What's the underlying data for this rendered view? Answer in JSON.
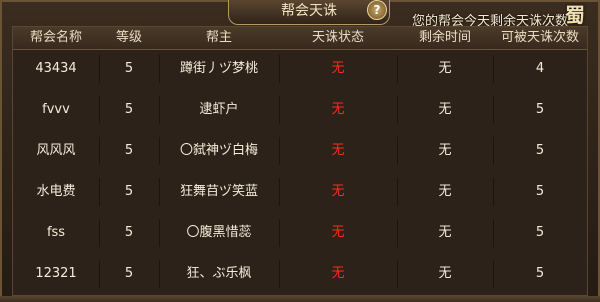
{
  "title": "帮会天诛",
  "help_label": "?",
  "count_label": "您的帮会今天剩余天诛次数",
  "logo_text": "蜀門",
  "columns": [
    "帮会名称",
    "等级",
    "帮主",
    "天诛状态",
    "剩余时间",
    "可被天诛次数"
  ],
  "rows": [
    {
      "name": "43434",
      "level": "5",
      "leader": "蹲街丿ヅ梦桃",
      "status": "无",
      "remaining": "无",
      "times": "4"
    },
    {
      "name": "fvvv",
      "level": "5",
      "leader": "逮虾户",
      "status": "无",
      "remaining": "无",
      "times": "5"
    },
    {
      "name": "风风风",
      "level": "5",
      "leader": "〇弑神ヅ白梅",
      "status": "无",
      "remaining": "无",
      "times": "5"
    },
    {
      "name": "水电费",
      "level": "5",
      "leader": "狂舞䒤ヅ笑蓝",
      "status": "无",
      "remaining": "无",
      "times": "5"
    },
    {
      "name": "fss",
      "level": "5",
      "leader": "〇腹黑惜蕊",
      "status": "无",
      "remaining": "无",
      "times": "5"
    },
    {
      "name": "12321",
      "level": "5",
      "leader": "狂、ぶ乐枫",
      "status": "无",
      "remaining": "无",
      "times": "5"
    }
  ],
  "colors": {
    "status_none": "#ff2a1a",
    "text": "#f4ecd9"
  }
}
